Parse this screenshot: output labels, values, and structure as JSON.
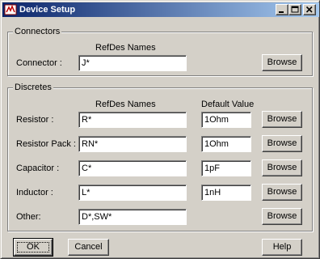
{
  "window": {
    "title": "Device Setup"
  },
  "connectors": {
    "group_title": "Connectors",
    "refdes_header": "RefDes Names",
    "row": {
      "label": "Connector :",
      "refdes": "J*",
      "browse": "Browse"
    }
  },
  "discretes": {
    "group_title": "Discretes",
    "refdes_header": "RefDes Names",
    "default_header": "Default Value",
    "rows": [
      {
        "label": "Resistor :",
        "refdes": "R*",
        "default": "1Ohm",
        "browse": "Browse"
      },
      {
        "label": "Resistor Pack :",
        "refdes": "RN*",
        "default": "1Ohm",
        "browse": "Browse"
      },
      {
        "label": "Capacitor :",
        "refdes": "C*",
        "default": "1pF",
        "browse": "Browse"
      },
      {
        "label": "Inductor :",
        "refdes": "L*",
        "default": "1nH",
        "browse": "Browse"
      },
      {
        "label": "Other:",
        "refdes": "D*,SW*",
        "browse": "Browse"
      }
    ]
  },
  "buttons": {
    "ok": "OK",
    "cancel": "Cancel",
    "help": "Help"
  }
}
